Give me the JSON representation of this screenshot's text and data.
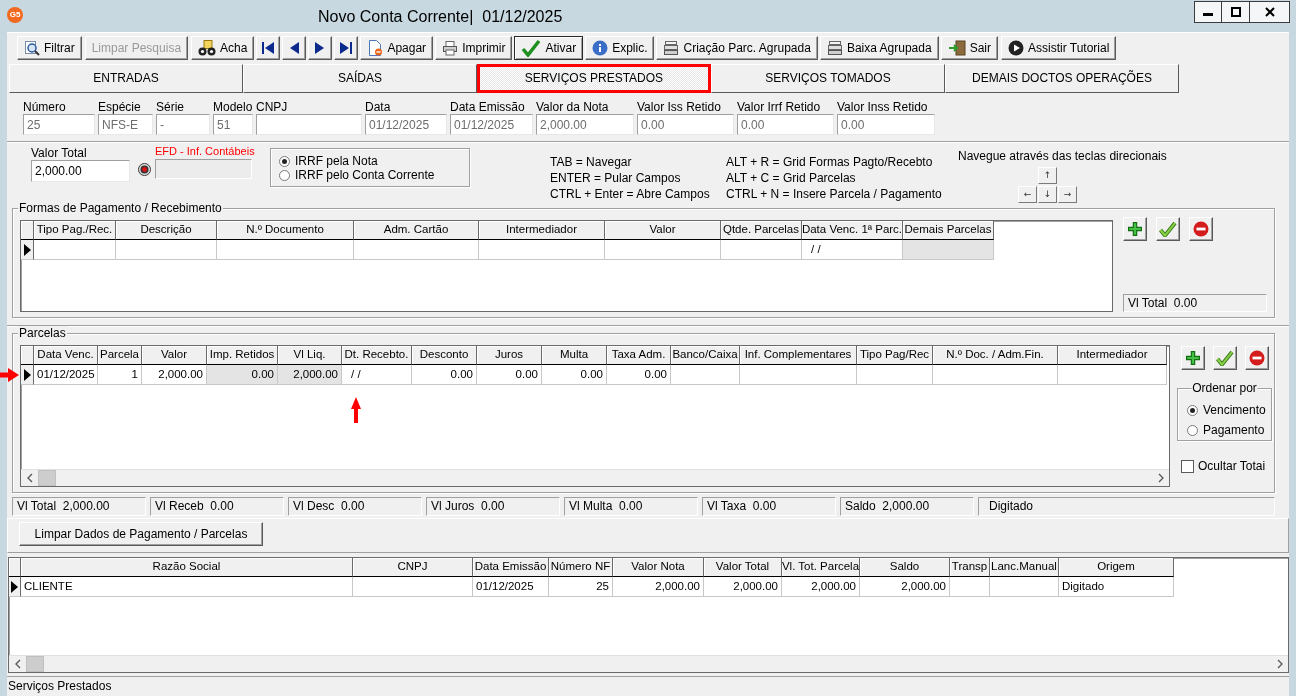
{
  "window": {
    "logo": "G5",
    "title": "Novo Conta Corrente|  01/12/2025"
  },
  "toolbar": [
    {
      "kind": "filter",
      "label": "Filtrar",
      "disabled": false,
      "pressed": false
    },
    {
      "kind": "text",
      "label": "Limpar Pesquisa",
      "disabled": true,
      "pressed": false
    },
    {
      "kind": "find",
      "label": "Acha",
      "disabled": false,
      "pressed": false
    },
    {
      "kind": "first",
      "disabled": false,
      "pressed": false
    },
    {
      "kind": "previous",
      "disabled": false,
      "pressed": false
    },
    {
      "kind": "next",
      "disabled": false,
      "pressed": false
    },
    {
      "kind": "last",
      "disabled": false,
      "pressed": false
    },
    {
      "kind": "delete",
      "label": "Apagar",
      "disabled": false,
      "pressed": false
    },
    {
      "kind": "print",
      "label": "Imprimir",
      "disabled": false,
      "pressed": false
    },
    {
      "kind": "check",
      "label": "Ativar",
      "disabled": false,
      "pressed": true
    },
    {
      "kind": "info",
      "label": "Explic.",
      "disabled": false,
      "pressed": false
    },
    {
      "kind": "batch",
      "label": "Criação Parc. Agrupada",
      "disabled": false,
      "pressed": false
    },
    {
      "kind": "batch",
      "label": "Baixa Agrupada",
      "disabled": false,
      "pressed": false
    },
    {
      "kind": "exit",
      "label": "Sair",
      "disabled": false,
      "pressed": false
    },
    {
      "kind": "play",
      "label": "Assistir Tutorial",
      "disabled": false,
      "pressed": false
    }
  ],
  "tabs": [
    {
      "label": "ENTRADAS",
      "selected": false,
      "highlighted": false
    },
    {
      "label": "SAÍDAS",
      "selected": false,
      "highlighted": false
    },
    {
      "label": "SERVIÇOS PRESTADOS",
      "selected": true,
      "highlighted": true
    },
    {
      "label": "SERVIÇOS TOMADOS",
      "selected": false,
      "highlighted": false
    },
    {
      "label": "DEMAIS DOCTOS OPERAÇÕES",
      "selected": false,
      "highlighted": false
    }
  ],
  "header_fields": [
    {
      "label": "Número",
      "value": "25"
    },
    {
      "label": "Espécie",
      "value": "NFS-E"
    },
    {
      "label": "Série",
      "value": "-"
    },
    {
      "label": "Modelo",
      "value": "51"
    },
    {
      "label": "CNPJ"
    },
    {
      "label": "Data",
      "value": "01/12/2025"
    },
    {
      "label": "Data Emissão",
      "value": "01/12/2025"
    },
    {
      "label": "Valor da Nota",
      "value": "2,000.00"
    },
    {
      "label": "Valor Iss Retido",
      "value": "0.00"
    },
    {
      "label": "Valor Irrf Retido",
      "value": "0.00"
    },
    {
      "label": "Valor Inss Retido",
      "value": "0.00"
    }
  ],
  "valor_total": {
    "label": "Valor Total",
    "value": "2,000.00"
  },
  "efd": {
    "label": "EFD - Inf. Contábeis",
    "disabled": true
  },
  "irrf_options": [
    {
      "label": "IRRF pela Nota",
      "selected": true
    },
    {
      "label": "IRRF pelo Conta Corrente",
      "selected": false
    }
  ],
  "shortcuts": [
    [
      "TAB = Navegar",
      "ENTER = Pular Campos",
      "CTRL + Enter = Abre Campos"
    ],
    [
      "ALT + R = Grid Formas Pagto/Recebto",
      "ALT + C = Grid Parcelas",
      "CTRL + N = Insere Parcela / Pagamento"
    ]
  ],
  "navigation": {
    "hint": "Navegue através das teclas direcionais",
    "keys": [
      "↑",
      "←",
      "↓",
      "→"
    ]
  },
  "payment_forms": {
    "legend": "Formas de Pagamento / Recebimento",
    "columns": [
      {
        "label": "Tipo Pag./Rec.",
        "shaded": false
      },
      {
        "label": "Descrição",
        "shaded": false
      },
      {
        "label": "N.º Documento",
        "shaded": false
      },
      {
        "label": "Adm. Cartão",
        "shaded": false
      },
      {
        "label": "Intermediador",
        "shaded": false
      },
      {
        "label": "Valor",
        "shaded": false
      },
      {
        "label": "Qtde. Parcelas",
        "shaded": false
      },
      {
        "label": "Data Venc. 1ª Parc.",
        "shaded": false
      },
      {
        "label": "Demais Parcelas",
        "shaded": true
      }
    ],
    "rows": [
      {
        "selected": true,
        "cells": [
          null,
          null,
          null,
          null,
          null,
          null,
          null,
          "/ /",
          null
        ]
      }
    ],
    "total": "Vl Total  0.00"
  },
  "parcelas": {
    "legend": "Parcelas",
    "columns": [
      {
        "label": "Data Venc.",
        "shaded": false,
        "flagged": false
      },
      {
        "label": "Parcela",
        "shaded": false,
        "flagged": false
      },
      {
        "label": "Valor",
        "shaded": false,
        "flagged": false
      },
      {
        "label": "Imp. Retidos",
        "shaded": true,
        "flagged": false
      },
      {
        "label": "Vl Liq.",
        "shaded": true,
        "flagged": false
      },
      {
        "label": "Dt. Recebto.",
        "shaded": false,
        "flagged": true
      },
      {
        "label": "Desconto",
        "shaded": false,
        "flagged": false
      },
      {
        "label": "Juros",
        "shaded": false,
        "flagged": false
      },
      {
        "label": "Multa",
        "shaded": false,
        "flagged": false
      },
      {
        "label": "Taxa Adm.",
        "shaded": false,
        "flagged": false
      },
      {
        "label": "Banco/Caixa",
        "shaded": false,
        "flagged": false
      },
      {
        "label": "Inf. Complementares",
        "shaded": false,
        "flagged": false
      },
      {
        "label": "Tipo Pag/Rec",
        "shaded": false,
        "flagged": false
      },
      {
        "label": "N.º Doc. / Adm.Fin.",
        "shaded": false,
        "flagged": false
      },
      {
        "label": "Intermediador",
        "shaded": false,
        "flagged": false
      }
    ],
    "rows": [
      {
        "selected": true,
        "flagged": true,
        "cells": [
          "01/12/2025",
          "1",
          "2,000.00",
          "0.00",
          "2,000.00",
          "/ /",
          "0.00",
          "0.00",
          "0.00",
          "0.00",
          null,
          null,
          null,
          null,
          null
        ]
      }
    ],
    "order": {
      "legend": "Ordenar por",
      "options": [
        {
          "label": "Vencimento",
          "selected": true
        },
        {
          "label": "Pagamento",
          "selected": false
        }
      ]
    },
    "hide_totals": {
      "label": "Ocultar Totai",
      "checked": false
    }
  },
  "totals": [
    "Vl Total  2,000.00",
    "Vl Receb  0.00",
    "Vl Desc  0.00",
    "Vl Juros  0.00",
    "Vl Multa  0.00",
    "Vl Taxa  0.00",
    "Saldo  2,000.00",
    "Digitado"
  ],
  "clear_button": "Limpar Dados de Pagamento / Parcelas",
  "documents": {
    "columns": [
      {
        "label": "Razão Social"
      },
      {
        "label": "CNPJ"
      },
      {
        "label": "Data Emissão"
      },
      {
        "label": "Número NF"
      },
      {
        "label": "Valor Nota"
      },
      {
        "label": "Valor Total"
      },
      {
        "label": "Vl. Tot. Parcela"
      },
      {
        "label": "Saldo"
      },
      {
        "label": "Transp"
      },
      {
        "label": "Lanc.Manual"
      },
      {
        "label": "Origem"
      }
    ],
    "rows": [
      {
        "selected": true,
        "cells": [
          "CLIENTE",
          null,
          "01/12/2025",
          "25",
          "2,000.00",
          "2,000.00",
          "2,000.00",
          "2,000.00",
          null,
          null,
          "Digitado"
        ]
      }
    ]
  },
  "status_bar": "Serviços Prestados"
}
